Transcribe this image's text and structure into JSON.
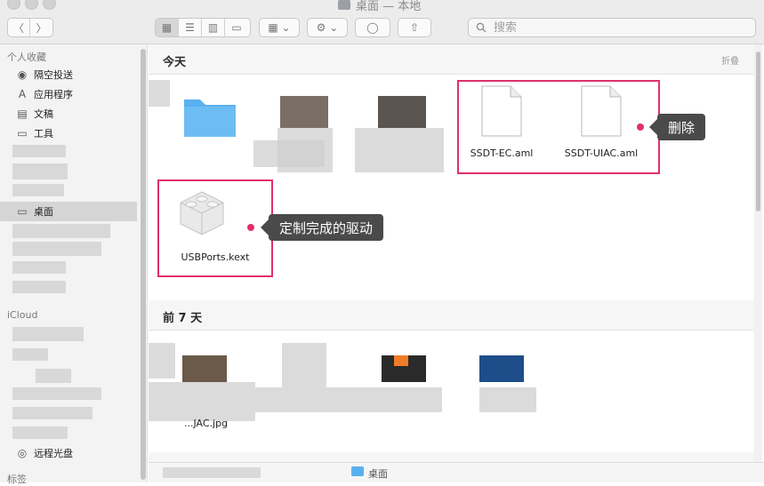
{
  "window": {
    "title": "桌面 — 本地"
  },
  "toolbar": {
    "back_label": "〈",
    "forward_label": "〉",
    "view_icons_label": "▦",
    "view_list_label": "☰",
    "view_columns_label": "▥",
    "view_gallery_label": "▭",
    "group_label": "▦ ⌄",
    "action_label": "⚙ ⌄",
    "tag_label": "◯",
    "share_label": "⇧",
    "search_placeholder": "搜索"
  },
  "sidebar": {
    "favorites_title": "个人收藏",
    "favorites": [
      {
        "label": "隔空投送",
        "icon": "airdrop-icon",
        "glyph": "◉"
      },
      {
        "label": "应用程序",
        "icon": "applications-icon",
        "glyph": "A"
      },
      {
        "label": "文稿",
        "icon": "documents-icon",
        "glyph": "▤"
      },
      {
        "label": "工具",
        "icon": "folder-icon",
        "glyph": "▭"
      }
    ],
    "desktop_item": {
      "label": "桌面",
      "glyph": "▭"
    },
    "icloud_title": "iCloud",
    "remote_disc": {
      "label": "远程光盘",
      "glyph": "◎"
    },
    "tags_title": "标签"
  },
  "main": {
    "today": {
      "title": "今天",
      "collapse_label": "折叠"
    },
    "files_today": [
      {
        "name": "SSDT-EC.aml"
      },
      {
        "name": "SSDT-UIAC.aml"
      },
      {
        "name": "USBPorts.kext"
      }
    ],
    "callouts": {
      "delete": "删除",
      "custom_driver": "定制完成的驱动"
    },
    "week": {
      "title": "前 7 天"
    },
    "week_partial_label": "...JAC.jpg"
  },
  "pathbar": {
    "desktop_label": "桌面"
  },
  "colors": {
    "highlight": "#e0306a",
    "callout_bg": "#4a4a4a",
    "folder_blue": "#5ab0ee"
  }
}
